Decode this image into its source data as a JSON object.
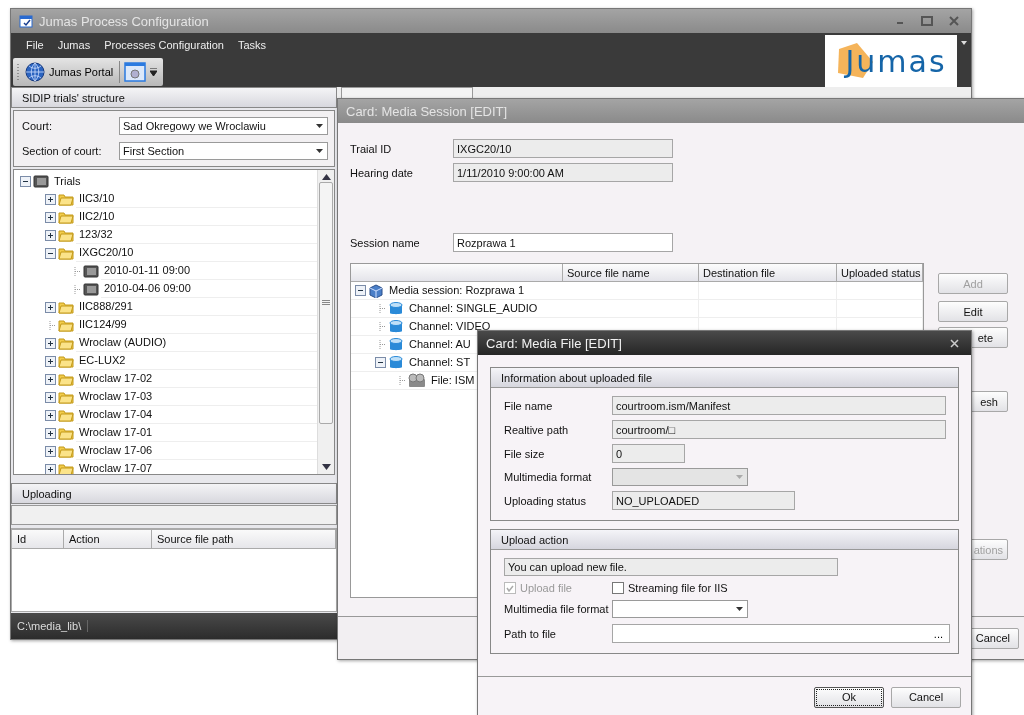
{
  "main_window": {
    "title": "Jumas Process Configuration",
    "menu": [
      "File",
      "Jumas",
      "Processes Configuration",
      "Tasks"
    ],
    "toolbar": {
      "portal_label": "Jumas Portal"
    },
    "logo_text": "Jumas",
    "left_panel": {
      "title": "SIDIP trials' structure",
      "court": {
        "label": "Court:",
        "value": "Sad Okregowy we Wroclawiu"
      },
      "section": {
        "label": "Section of court:",
        "value": "First Section"
      },
      "tree": [
        {
          "label": "Trials",
          "kind": "root",
          "expandable": true,
          "expanded": true,
          "children": [
            {
              "label": "IIC3/10",
              "kind": "folder",
              "expandable": true,
              "expanded": false
            },
            {
              "label": "IIC2/10",
              "kind": "folder",
              "expandable": true,
              "expanded": false
            },
            {
              "label": "123/32",
              "kind": "folder",
              "expandable": true,
              "expanded": false
            },
            {
              "label": "IXGC20/10",
              "kind": "folder",
              "expandable": true,
              "expanded": true,
              "children": [
                {
                  "label": "2010-01-11 09:00",
                  "kind": "hearing",
                  "expandable": false
                },
                {
                  "label": "2010-04-06 09:00",
                  "kind": "hearing",
                  "expandable": false
                }
              ]
            },
            {
              "label": "IIC888/291",
              "kind": "folder",
              "expandable": true,
              "expanded": false
            },
            {
              "label": "IIC124/99",
              "kind": "folder",
              "expandable": false
            },
            {
              "label": "Wroclaw (AUDIO)",
              "kind": "folder",
              "expandable": true,
              "expanded": false
            },
            {
              "label": "EC-LUX2",
              "kind": "folder",
              "expandable": true,
              "expanded": false
            },
            {
              "label": "Wroclaw 17-02",
              "kind": "folder",
              "expandable": true,
              "expanded": false
            },
            {
              "label": "Wroclaw 17-03",
              "kind": "folder",
              "expandable": true,
              "expanded": false
            },
            {
              "label": "Wroclaw 17-04",
              "kind": "folder",
              "expandable": true,
              "expanded": false
            },
            {
              "label": "Wroclaw 17-01",
              "kind": "folder",
              "expandable": true,
              "expanded": false
            },
            {
              "label": "Wroclaw 17-06",
              "kind": "folder",
              "expandable": true,
              "expanded": false
            },
            {
              "label": "Wroclaw 17-07",
              "kind": "folder",
              "expandable": true,
              "expanded": false
            }
          ]
        }
      ]
    },
    "uploading": {
      "title": "Uploading",
      "columns": [
        "Id",
        "Action",
        "Source file path"
      ]
    },
    "status_bar": "C:\\media_lib\\"
  },
  "media_session": {
    "title": "Card: Media Session [EDIT]",
    "fields": [
      {
        "label": "Traial ID",
        "value": "IXGC20/10",
        "readonly": true
      },
      {
        "label": "Hearing date",
        "value": "1/11/2010 9:00:00 AM",
        "readonly": true
      },
      {
        "label": "Session name",
        "value": "Rozprawa 1",
        "readonly": false
      }
    ],
    "grid": {
      "columns": [
        "Source file name",
        "Destination file",
        "Uploaded status"
      ],
      "tree": [
        {
          "label": "Media session: Rozprawa 1",
          "kind": "session",
          "expandable": true,
          "expanded": true,
          "children": [
            {
              "label": "Channel: SINGLE_AUDIO",
              "kind": "channel",
              "expandable": false
            },
            {
              "label": "Channel: VIDEO",
              "kind": "channel",
              "expandable": false
            },
            {
              "label": "Channel: AU",
              "kind": "channel",
              "expandable": false
            },
            {
              "label": "Channel: ST",
              "kind": "channel",
              "expandable": true,
              "expanded": true,
              "children": [
                {
                  "label": "File: ISM",
                  "kind": "file",
                  "expandable": false
                }
              ]
            }
          ]
        }
      ]
    },
    "buttons": [
      {
        "label": "Add",
        "disabled": true
      },
      {
        "label": "Edit",
        "disabled": false
      },
      {
        "label": "ete",
        "disabled": false
      },
      {
        "label": "esh",
        "disabled": false
      },
      {
        "label": "ations",
        "disabled": true
      }
    ],
    "cancel": "Cancel"
  },
  "media_file": {
    "title": "Card: Media File [EDIT]",
    "info_group": {
      "title": "Information about uploaded file",
      "rows": [
        {
          "label": "File name",
          "value": "courtroom.ism/Manifest",
          "kind": "text"
        },
        {
          "label": "Realtive path",
          "value": "courtroom/□",
          "kind": "text"
        },
        {
          "label": "File size",
          "value": "0",
          "kind": "short"
        },
        {
          "label": "Multimedia format",
          "kind": "combo"
        },
        {
          "label": "Uploading status",
          "value": "NO_UPLOADED",
          "kind": "medium"
        }
      ]
    },
    "upload_group": {
      "title": "Upload action",
      "message": "You can upload new file.",
      "upload_file": {
        "label": "Upload file",
        "checked": true,
        "disabled": true
      },
      "streaming": {
        "label": "Streaming file for IIS",
        "checked": false,
        "disabled": false
      },
      "format_label": "Multimedia file format",
      "path_label": "Path to file",
      "browse": "..."
    },
    "buttons": [
      {
        "label": "Ok",
        "focused": true
      },
      {
        "label": "Cancel",
        "focused": false
      }
    ]
  }
}
